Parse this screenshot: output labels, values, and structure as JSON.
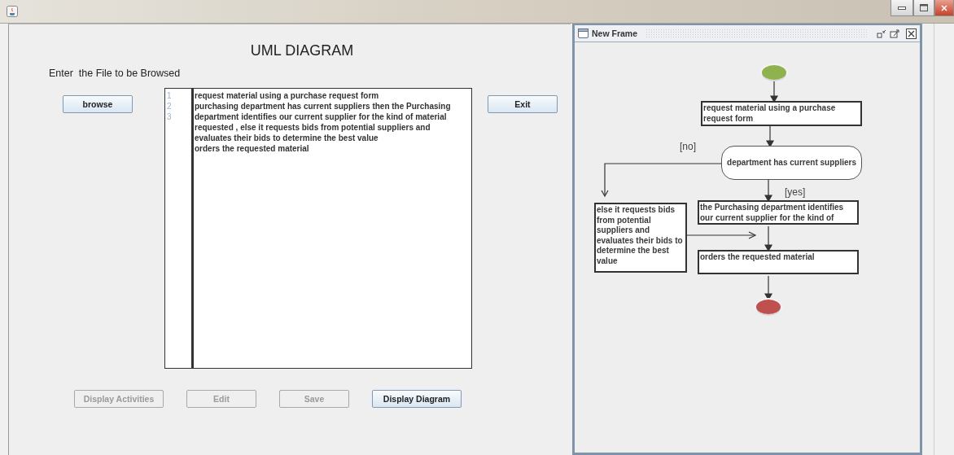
{
  "app": {
    "heading": "UML DIAGRAM",
    "file_label": "Enter  the File to be Browsed",
    "browse_button": "browse",
    "exit_button": "Exit",
    "editor": {
      "line_numbers": [
        "1",
        "2",
        "3"
      ],
      "lines": [
        "request material using a purchase request form",
        "purchasing department has current suppliers then the Purchasing",
        "department identifies our current supplier for the kind of material",
        "requested , else it requests bids from potential suppliers and",
        "evaluates their bids to determine the best value",
        "orders the requested material"
      ]
    },
    "actions": [
      {
        "label": "Display Activities",
        "disabled": true
      },
      {
        "label": "Edit",
        "disabled": true
      },
      {
        "label": "Save",
        "disabled": true
      },
      {
        "label": "Display Diagram",
        "disabled": false
      }
    ]
  },
  "frame": {
    "title": "New Frame",
    "nodes": [
      {
        "kind": "start"
      },
      {
        "kind": "action",
        "text": "request material using a purchase request form"
      },
      {
        "kind": "decision",
        "text": "department has current suppliers"
      },
      {
        "kind": "action",
        "text": " else it requests bids from potential suppliers and evaluates their bids to determine the best value"
      },
      {
        "kind": "action",
        "text": " the Purchasing department identifies our current supplier for the kind of"
      },
      {
        "kind": "action",
        "text": "orders the requested material"
      },
      {
        "kind": "end"
      }
    ],
    "guards": [
      "[no]",
      "[yes]"
    ]
  }
}
